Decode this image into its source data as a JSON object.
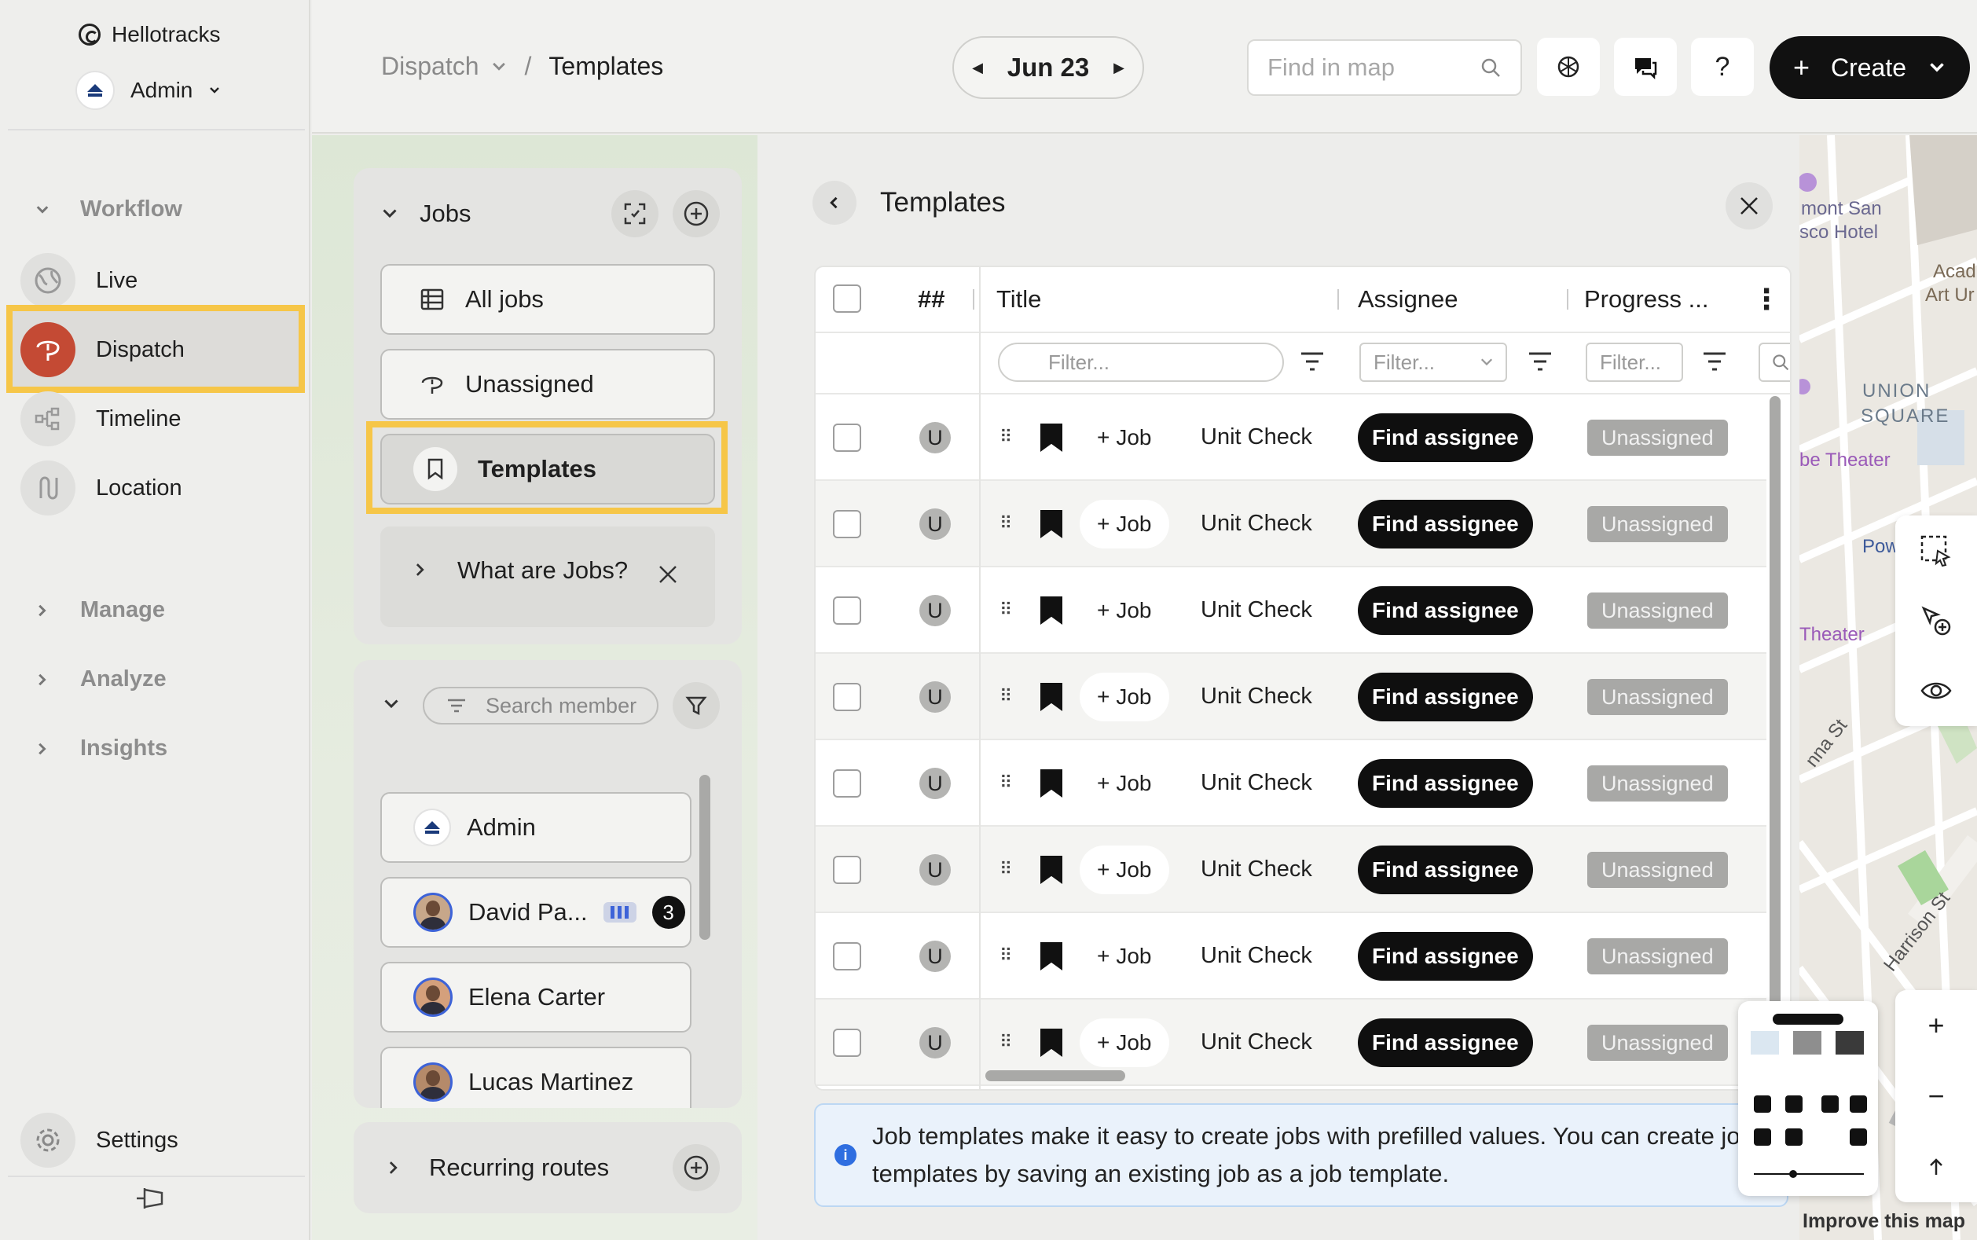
{
  "org": {
    "name": "Hellotracks"
  },
  "user": {
    "name": "Admin"
  },
  "sidebar": {
    "workflow_label": "Workflow",
    "items": [
      {
        "label": "Live"
      },
      {
        "label": "Dispatch"
      },
      {
        "label": "Timeline"
      },
      {
        "label": "Location"
      }
    ],
    "sections": [
      {
        "label": "Manage"
      },
      {
        "label": "Analyze"
      },
      {
        "label": "Insights"
      }
    ],
    "settings_label": "Settings"
  },
  "header": {
    "breadcrumb_root": "Dispatch",
    "breadcrumb_sep": "/",
    "breadcrumb_current": "Templates",
    "date": "Jun 23",
    "search_placeholder": "Find in map",
    "help_label": "?",
    "create_label": "Create"
  },
  "jobs_panel": {
    "title": "Jobs",
    "buttons": [
      {
        "label": "All jobs"
      },
      {
        "label": "Unassigned"
      },
      {
        "label": "Templates"
      }
    ],
    "what_label": "What are Jobs?"
  },
  "members_panel": {
    "search_placeholder": "Search member",
    "members": [
      {
        "name": "Admin"
      },
      {
        "name": "David Pa...",
        "count": "3"
      },
      {
        "name": "Elena Carter"
      },
      {
        "name": "Lucas Martinez"
      }
    ]
  },
  "routes_panel": {
    "label": "Recurring routes"
  },
  "templates": {
    "title": "Templates",
    "columns": {
      "num": "##",
      "title": "Title",
      "assignee": "Assignee",
      "progress": "Progress ..."
    },
    "filters": {
      "title": "Filter...",
      "assignee": "Filter...",
      "progress": "Filter..."
    },
    "rows": [
      {
        "avatar": "U",
        "add": "Job",
        "title": "Unit Check",
        "assignee": "Find assignee",
        "status": "Unassigned"
      },
      {
        "avatar": "U",
        "add": "Job",
        "title": "Unit Check",
        "assignee": "Find assignee",
        "status": "Unassigned"
      },
      {
        "avatar": "U",
        "add": "Job",
        "title": "Unit Check",
        "assignee": "Find assignee",
        "status": "Unassigned"
      },
      {
        "avatar": "U",
        "add": "Job",
        "title": "Unit Check",
        "assignee": "Find assignee",
        "status": "Unassigned"
      },
      {
        "avatar": "U",
        "add": "Job",
        "title": "Unit Check",
        "assignee": "Find assignee",
        "status": "Unassigned"
      },
      {
        "avatar": "U",
        "add": "Job",
        "title": "Unit Check",
        "assignee": "Find assignee",
        "status": "Unassigned"
      },
      {
        "avatar": "U",
        "add": "Job",
        "title": "Unit Check",
        "assignee": "Find assignee",
        "status": "Unassigned"
      },
      {
        "avatar": "U",
        "add": "Job",
        "title": "Unit Check",
        "assignee": "Find assignee",
        "status": "Unassigned"
      }
    ],
    "info_text": "Job templates make it easy to create jobs with prefilled values. You can create job templates by saving an existing job as a job template."
  },
  "map": {
    "labels": [
      {
        "text": "mont San"
      },
      {
        "text": "sco Hotel"
      },
      {
        "text": "Acad"
      },
      {
        "text": "Art Ur"
      },
      {
        "text": "UNION"
      },
      {
        "text": "SQUARE"
      },
      {
        "text": "be Theater"
      },
      {
        "text": "Powell"
      },
      {
        "text": "Theater"
      },
      {
        "text": "Harrison St"
      },
      {
        "text": "nna St"
      }
    ],
    "improve_label": "Improve this map"
  },
  "colors": {
    "accent": "#c44a34",
    "highlight": "#f6c648",
    "primary": "#111111"
  }
}
